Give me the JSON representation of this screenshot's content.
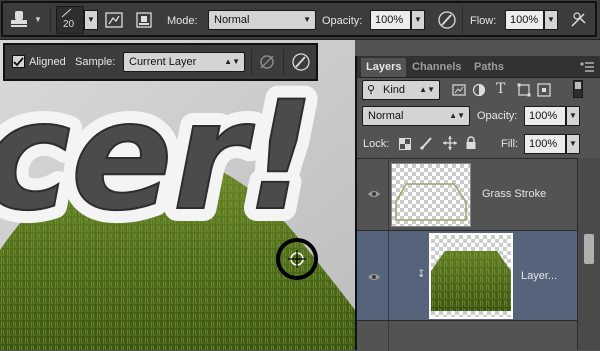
{
  "options_bar": {
    "brush_size": "20",
    "mode_label": "Mode:",
    "mode_value": "Normal",
    "opacity_label": "Opacity:",
    "opacity_value": "100%",
    "flow_label": "Flow:",
    "flow_value": "100%"
  },
  "sub_options": {
    "aligned_label": "Aligned",
    "sample_label": "Sample:",
    "sample_value": "Current Layer"
  },
  "canvas": {
    "artwork_text": "cer!"
  },
  "layers_panel": {
    "tabs": [
      {
        "label": "Layers",
        "active": true
      },
      {
        "label": "Channels",
        "active": false
      },
      {
        "label": "Paths",
        "active": false
      }
    ],
    "filter_kind": "Kind",
    "blend_mode": "Normal",
    "opacity_label": "Opacity:",
    "opacity_value": "100%",
    "lock_label": "Lock:",
    "fill_label": "Fill:",
    "fill_value": "100%",
    "layers": [
      {
        "name": "Grass Stroke",
        "selected": false
      },
      {
        "name": "Layer...",
        "selected": true
      }
    ]
  },
  "colors": {
    "panel_bg": "#535353",
    "selected_row": "#56647b",
    "toolbar_bg": "#3c3c3c"
  }
}
